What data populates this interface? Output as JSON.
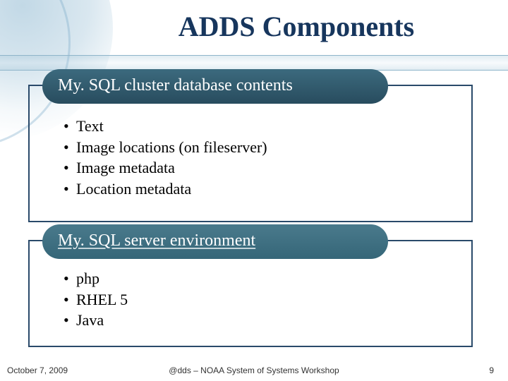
{
  "title": "ADDS Components",
  "section1": {
    "heading": "My. SQL cluster database contents",
    "items": [
      "Text",
      "Image locations (on fileserver)",
      "Image metadata",
      "Location metadata"
    ]
  },
  "section2": {
    "heading": "My. SQL server environment",
    "items": [
      "php",
      "RHEL 5",
      "Java"
    ]
  },
  "footer": {
    "date": "October 7, 2009",
    "center": "@dds – NOAA System of Systems Workshop",
    "page": "9"
  }
}
